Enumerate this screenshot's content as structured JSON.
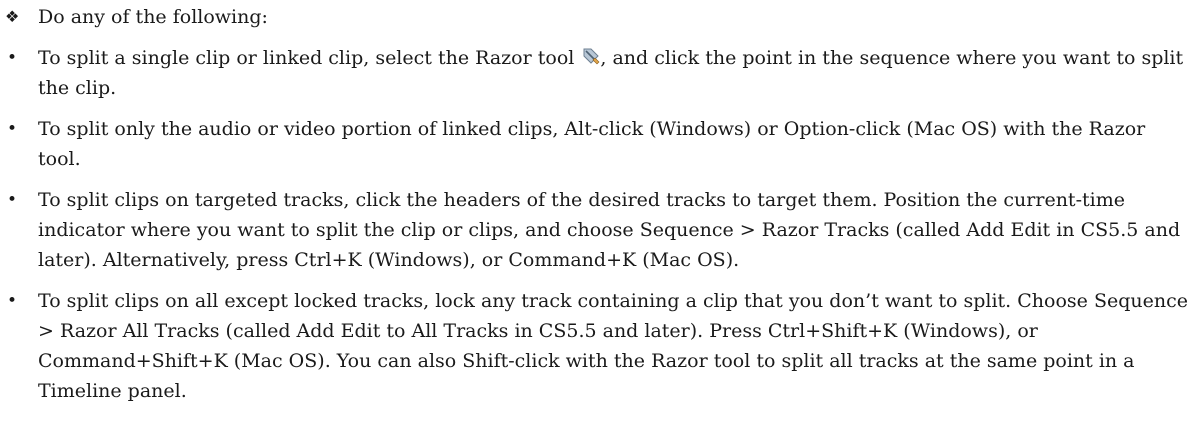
{
  "intro": {
    "bullet_glyph": "❖",
    "text": "Do any of the following:"
  },
  "items": [
    {
      "bullet_glyph": "•",
      "text_before_icon": "To split a single clip or linked clip, select the Razor tool ",
      "icon": "razor-tool-icon",
      "text_after_icon": ", and click the point in the sequence where you want to split the clip."
    },
    {
      "bullet_glyph": "•",
      "text": "To split only the audio or video portion of linked clips, Alt-click (Windows) or Option-click (Mac OS) with the Razor tool."
    },
    {
      "bullet_glyph": "•",
      "text": "To split clips on targeted tracks, click the headers of the desired tracks to target them. Position the current-time indicator where you want to split the clip or clips, and choose Sequence > Razor Tracks (called Add Edit in CS5.5 and later). Alternatively, press Ctrl+K (Windows), or Command+K (Mac OS)."
    },
    {
      "bullet_glyph": "•",
      "text": "To split clips on all except locked tracks, lock any track containing a clip that you don’t want to split. Choose Sequence > Razor All Tracks (called Add Edit to All Tracks in CS5.5 and later). Press Ctrl+Shift+K (Windows), or Command+Shift+K (Mac OS). You can also Shift-click with the Razor tool to split all tracks at the same point in a Timeline panel."
    }
  ]
}
